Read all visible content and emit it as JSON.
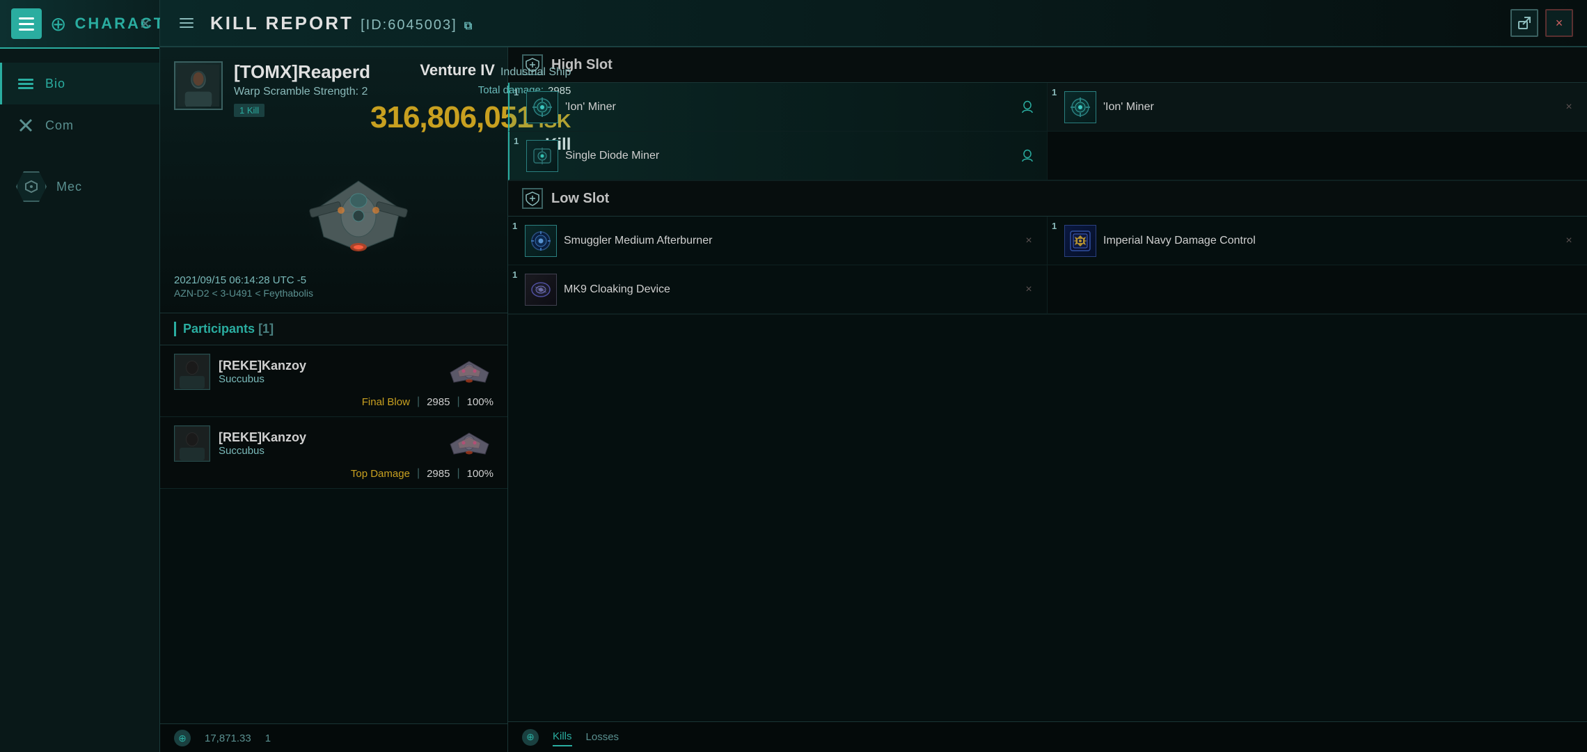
{
  "app": {
    "title": "CHARACTER",
    "close_label": "×"
  },
  "sidebar": {
    "hamburger_label": "menu",
    "vitruvian_label": "⊕",
    "title": "CHARACTER",
    "close_label": "×",
    "nav": {
      "bio_label": "Bio",
      "combat_label": "Com",
      "mechanics_label": "Mec"
    }
  },
  "modal": {
    "title": "KILL REPORT",
    "id": "[ID:6045003]",
    "copy_icon": "⧉",
    "external_link_icon": "⬡",
    "close_icon": "×"
  },
  "victim": {
    "name": "[TOMX]Reaperd",
    "warp_scramble": "Warp Scramble Strength: 2",
    "kill_count": "1 Kill",
    "timestamp": "2021/09/15 06:14:28 UTC -5",
    "location": "AZN-D2 < 3-U491 < Feythabolis"
  },
  "ship": {
    "class": "Venture IV",
    "type": "Industrial Ship",
    "total_damage_label": "Total damage:",
    "total_damage_value": "2985",
    "isk_value": "316,806,051",
    "isk_label": "ISK",
    "result": "Kill"
  },
  "participants": {
    "title": "Participants",
    "count": "[1]",
    "list": [
      {
        "name": "[REKE]Kanzoy",
        "ship": "Succubus",
        "blow_type": "Final Blow",
        "damage": "2985",
        "percent": "100%"
      },
      {
        "name": "[REKE]Kanzoy",
        "ship": "Succubus",
        "blow_type": "Top Damage",
        "damage": "2985",
        "percent": "100%"
      }
    ]
  },
  "bottom_bar": {
    "value": "17,871.33",
    "suffix": "1"
  },
  "slots": {
    "high_slot": {
      "label": "High Slot",
      "items": [
        {
          "qty": "1",
          "name": "'Ion' Miner",
          "highlighted": true,
          "has_user": true
        },
        {
          "qty": "1",
          "name": "'Ion' Miner",
          "highlighted": false,
          "has_close": true
        },
        {
          "qty": "1",
          "name": "Single Diode Miner",
          "highlighted": true,
          "has_user": true
        },
        {
          "qty": "",
          "name": "",
          "highlighted": false,
          "empty": true
        }
      ]
    },
    "low_slot": {
      "label": "Low Slot",
      "items": [
        {
          "qty": "1",
          "name": "Smuggler Medium Afterburner",
          "highlighted": false,
          "has_close": true
        },
        {
          "qty": "1",
          "name": "Imperial Navy Damage Control",
          "highlighted": false,
          "has_close": true
        },
        {
          "qty": "1",
          "name": "MK9 Cloaking Device",
          "highlighted": false,
          "has_close": true
        },
        {
          "qty": "",
          "name": "",
          "highlighted": false,
          "empty": true
        }
      ]
    }
  },
  "slots_bottom": {
    "kills_label": "Kills",
    "losses_label": "Losses"
  }
}
